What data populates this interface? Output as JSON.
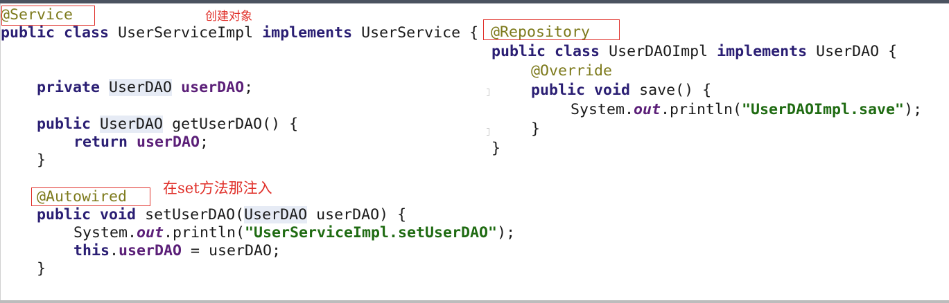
{
  "left_panel": {
    "annotation_service": "@Service",
    "class_decl": {
      "kw_public": "public",
      "kw_class": "class",
      "class_name": "UserServiceImpl",
      "kw_implements": "implements",
      "iface": "UserService",
      "brace": "{"
    },
    "field_decl": {
      "kw_private": "private",
      "type": "UserDAO",
      "name": "userDAO",
      "semi": ";"
    },
    "getter": {
      "kw_public": "public",
      "type": "UserDAO",
      "signature": "getUserDAO() {",
      "kw_return": "return",
      "field": "userDAO",
      "semi": ";",
      "close": "}"
    },
    "annotation_autowired": "@Autowired",
    "setter": {
      "kw_public": "public",
      "kw_void": "void",
      "name_open": "setUserDAO(",
      "param_type": "UserDAO",
      "param_rest": " userDAO) {",
      "sys_prefix": "System.",
      "out": "out",
      "println_open": ".println(",
      "string": "\"UserServiceImpl.setUserDAO\"",
      "println_close": ");",
      "kw_this": "this",
      "dot": ".",
      "field": "userDAO",
      "assign": " = userDAO;",
      "close": "}"
    }
  },
  "right_panel": {
    "annotation_repository": "@Repository",
    "class_decl": {
      "kw_public": "public",
      "kw_class": "class",
      "class_name": "UserDAOImpl",
      "kw_implements": "implements",
      "iface": "UserDAO",
      "brace": "{"
    },
    "annotation_override": "@Override",
    "method": {
      "kw_public": "public",
      "kw_void": "void",
      "signature": "save() {",
      "sys_prefix": "System.",
      "out": "out",
      "println_open": ".println(",
      "string": "\"UserDAOImpl.save\"",
      "println_close": ");",
      "close": "}"
    },
    "class_close": "}"
  },
  "notes": {
    "create_object": "创建对象",
    "set_inject": "在set方法那注入"
  },
  "colors": {
    "keyword": "#2a1e73",
    "field": "#5b1f78",
    "string": "#1f6b12",
    "annotation": "#7d7a1c",
    "highlight": "#e6ebf5",
    "red_note": "#e0302a"
  }
}
